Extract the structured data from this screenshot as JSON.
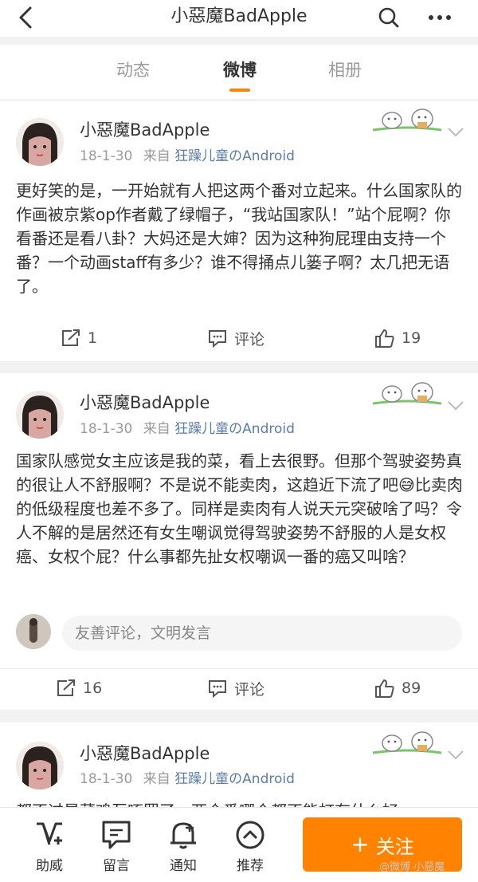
{
  "header": {
    "title": "小惡魔BadApple"
  },
  "tabs": [
    {
      "label": "动态"
    },
    {
      "label": "微博"
    },
    {
      "label": "相册"
    }
  ],
  "posts": [
    {
      "username": "小惡魔BadApple",
      "date": "18-1-30",
      "source_prefix": "来自",
      "source": "狂躁儿童のAndroid",
      "text": "更好笑的是，一开始就有人把这两个番对立起来。什么国家队的作画被京紫op作者戴了绿帽子，“我站国家队！”站个屁啊？你看番还是看八卦？大妈还是大婶？因为这种狗屁理由支持一个番？一个动画staff有多少？谁不得捅点儿篓子啊？太几把无语了。",
      "repost_count": "1",
      "comment_label": "评论",
      "like_count": "19"
    },
    {
      "username": "小惡魔BadApple",
      "date": "18-1-30",
      "source_prefix": "来自",
      "source": "狂躁儿童のAndroid",
      "text": "国家队感觉女主应该是我的菜，看上去很野。但那个驾驶姿势真的很让人不舒服啊？不是说不能卖肉，这趋近下流了吧😅比卖肉的低级程度也差不多了。同样是卖肉有人说天元突破啥了吗？令人不解的是居然还有女生嘲讽觉得驾驶姿势不舒服的人是女权癌、女权个屁？什么事都先扯女权嘲讽一番的癌又叫啥？",
      "comment_placeholder": "友善评论，文明发言",
      "repost_count": "16",
      "comment_label": "评论",
      "like_count": "89"
    },
    {
      "username": "小惡魔BadApple",
      "date": "18-1-30",
      "source_prefix": "来自",
      "source": "狂躁儿童のAndroid",
      "text": "都不过是菜鸡互啄罢了，两个番哪个都不能打有什么好"
    }
  ],
  "bottom_bar": {
    "items": [
      {
        "label": "助威"
      },
      {
        "label": "留言"
      },
      {
        "label": "通知"
      },
      {
        "label": "推荐"
      }
    ],
    "follow_label": "关注",
    "follow_plus": "+"
  },
  "watermark": "@微博 小惡魔",
  "colors": {
    "accent": "#ff8200",
    "source_link": "#5b7dab"
  }
}
